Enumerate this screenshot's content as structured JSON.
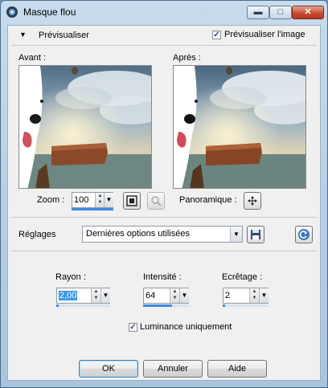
{
  "window": {
    "title": "Masque flou",
    "controls": {
      "minimize": "▬",
      "maximize": "□",
      "close": "✕"
    }
  },
  "preview_bar": {
    "collapse_arrow": "▼",
    "label": "Prévisualiser",
    "checkbox_label": "Prévisualiser l'image",
    "checkbox_checked": true
  },
  "previews": {
    "before_label": "Avant :",
    "after_label": "Après :"
  },
  "zoom": {
    "label": "Zoom :",
    "value": "100",
    "fit_icon": "zoom-fit-icon",
    "zoom_icon": "magnifier-icon"
  },
  "pan": {
    "label": "Panoramique :",
    "icon": "move-arrows-icon"
  },
  "presets": {
    "label": "Réglages",
    "selected": "Dernières options utilisées",
    "save_icon": "floppy-disk-icon",
    "reset_icon": "reset-arrow-icon"
  },
  "params": {
    "radius": {
      "label": "Rayon :",
      "value": "2,00",
      "level": 0.02
    },
    "intensity": {
      "label": "Intensité :",
      "value": "64",
      "level": 0.64
    },
    "clipping": {
      "label": "Ecrêtage :",
      "value": "2",
      "level": 0.02
    },
    "luminance": {
      "label": "Luminance uniquement",
      "checked": true
    }
  },
  "buttons": {
    "ok": "OK",
    "cancel": "Annuler",
    "help": "Aide"
  },
  "colors": {
    "accent": "#3c8ae0",
    "title_bar": "#b9d1ea",
    "close_button": "#c9462f"
  }
}
